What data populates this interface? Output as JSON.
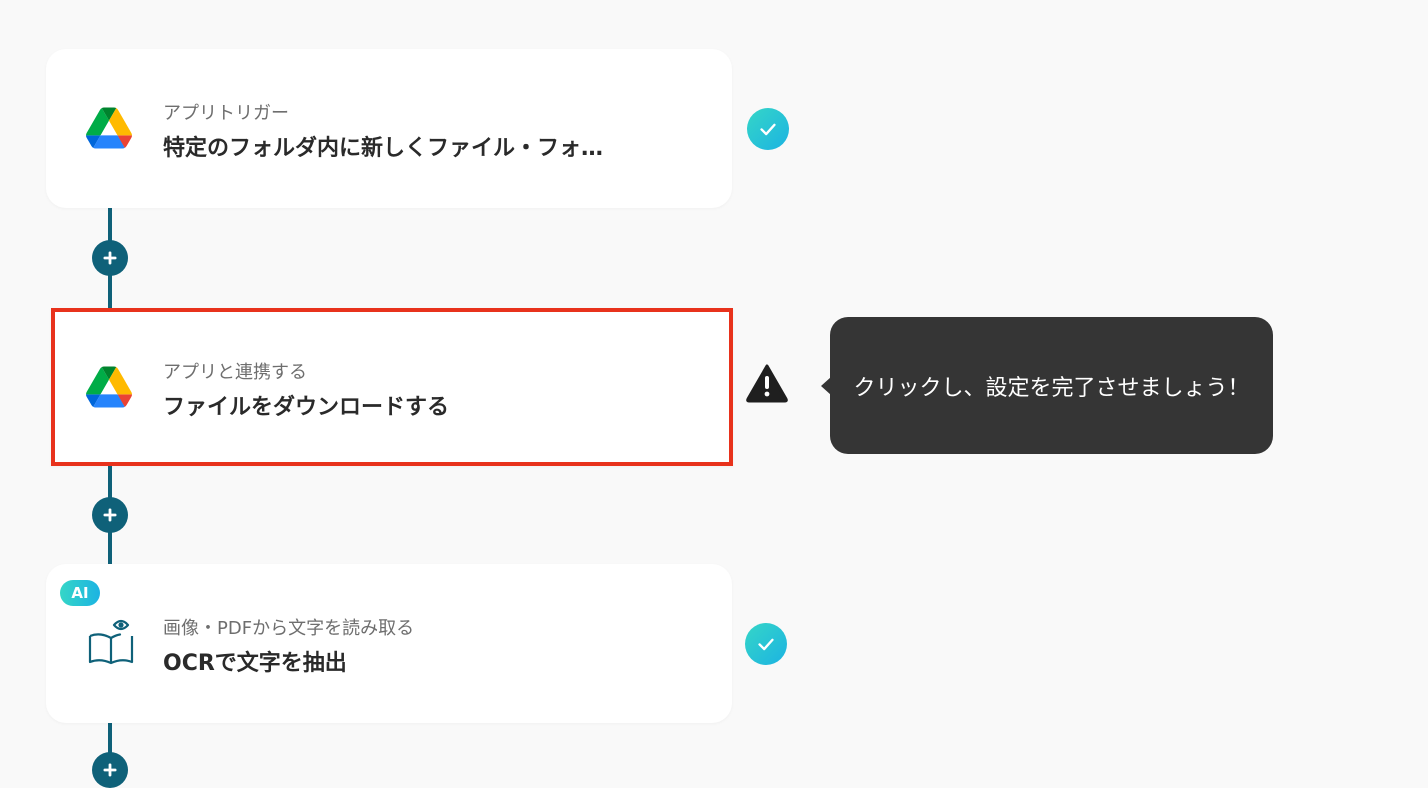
{
  "steps": [
    {
      "subtitle": "アプリトリガー",
      "title": "特定のフォルダ内に新しくファイル・フォ…",
      "icon": "google-drive-icon",
      "status": "completed"
    },
    {
      "subtitle": "アプリと連携する",
      "title": "ファイルをダウンロードする",
      "icon": "google-drive-icon",
      "status": "warning"
    },
    {
      "subtitle": "画像・PDFから文字を読み取る",
      "title": "OCRで文字を抽出",
      "icon": "book-eye-icon",
      "badge": "AI",
      "status": "completed"
    }
  ],
  "tooltip": {
    "text": "クリックし、設定を完了させましょう！"
  },
  "colors": {
    "connector": "#0f6179",
    "highlight_border": "#e8321c",
    "check_gradient_start": "#35d6c7",
    "check_gradient_end": "#1cb3e2",
    "tooltip_bg": "#353535"
  }
}
